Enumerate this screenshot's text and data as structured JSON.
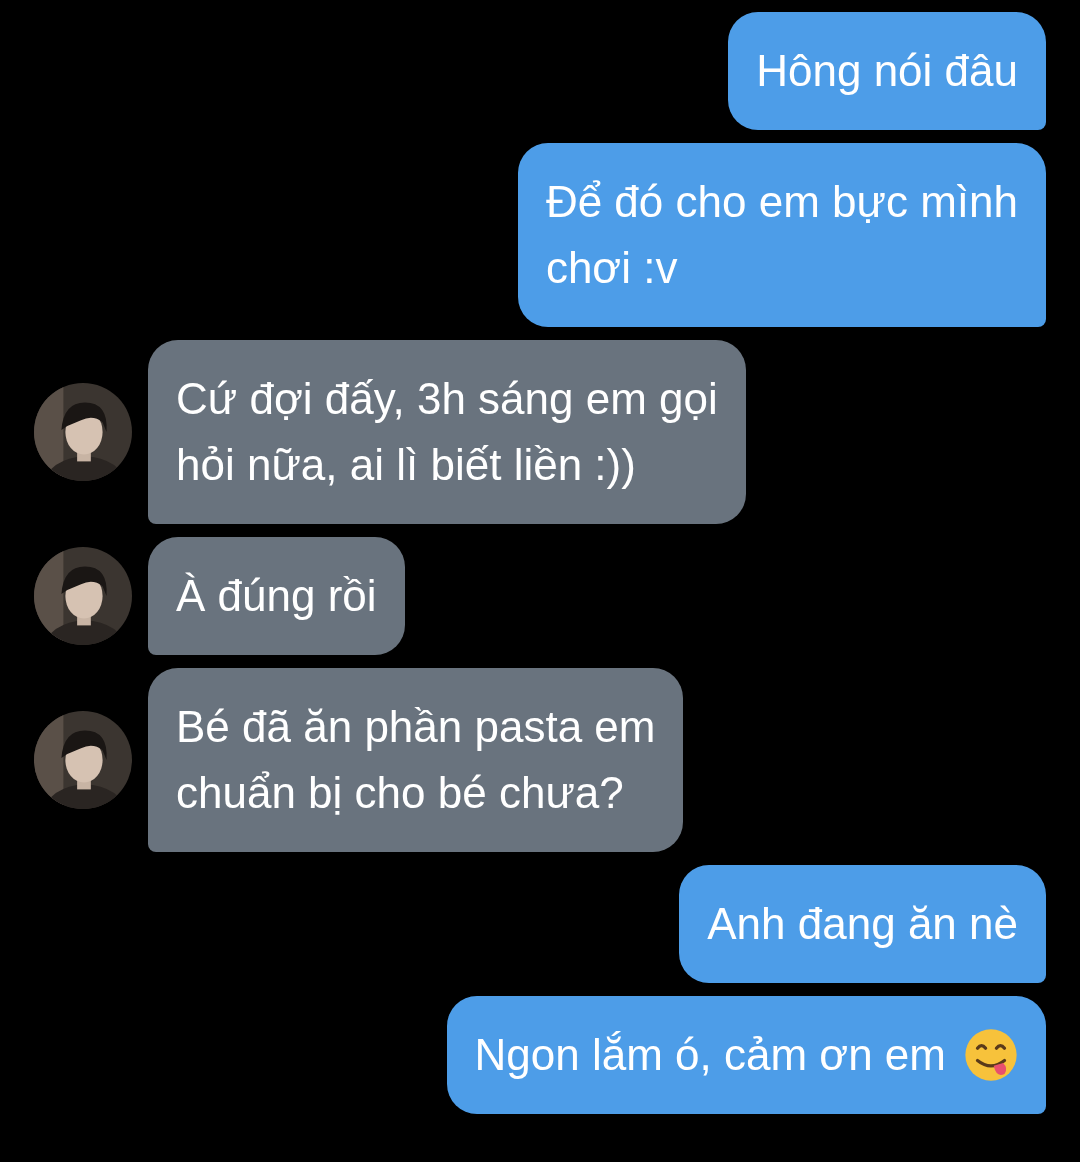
{
  "messages": [
    {
      "kind": "outgoing",
      "lines": [
        "Hông nói đâu"
      ]
    },
    {
      "kind": "outgoing",
      "lines": [
        "Để đó cho em bực mình",
        "chơi :v"
      ]
    },
    {
      "kind": "incoming",
      "lines": [
        "Cứ đợi đấy, 3h sáng em gọi",
        "hỏi nữa, ai lì biết liền :))"
      ]
    },
    {
      "kind": "incoming",
      "lines": [
        "À đúng rồi"
      ]
    },
    {
      "kind": "incoming",
      "lines": [
        "Bé đã ăn phần pasta em",
        "chuẩn bị cho bé chưa?"
      ]
    },
    {
      "kind": "outgoing",
      "lines": [
        "Anh đang ăn nè"
      ]
    },
    {
      "kind": "outgoing",
      "lines": [
        "Ngon lắm ó, cảm ơn em"
      ],
      "emoji": true
    }
  ]
}
